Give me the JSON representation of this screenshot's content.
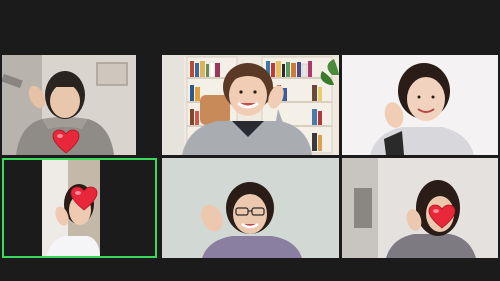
{
  "app": {
    "view": "gallery-view",
    "background_color": "#1b1b1b",
    "active_speaker_color": "#3ad95b"
  },
  "participants": [
    {
      "id": 1,
      "video": "on",
      "face_cover": "heart-emoji",
      "gesture": "hand-wave"
    },
    {
      "id": 2,
      "video": "on",
      "face_cover": "none",
      "gesture": "hand-wave",
      "backdrop": "bookshelf"
    },
    {
      "id": 3,
      "video": "on",
      "face_cover": "none",
      "gesture": "hand-wave"
    },
    {
      "id": 4,
      "video": "on",
      "face_cover": "heart-emoji",
      "gesture": "hand-wave",
      "active_speaker": true
    },
    {
      "id": 5,
      "video": "on",
      "face_cover": "none",
      "gesture": "hand-wave"
    },
    {
      "id": 6,
      "video": "on",
      "face_cover": "heart-emoji",
      "gesture": "hand-wave"
    }
  ],
  "colors": {
    "heart": "#e8283a",
    "heart_highlight": "#ff8b96"
  }
}
